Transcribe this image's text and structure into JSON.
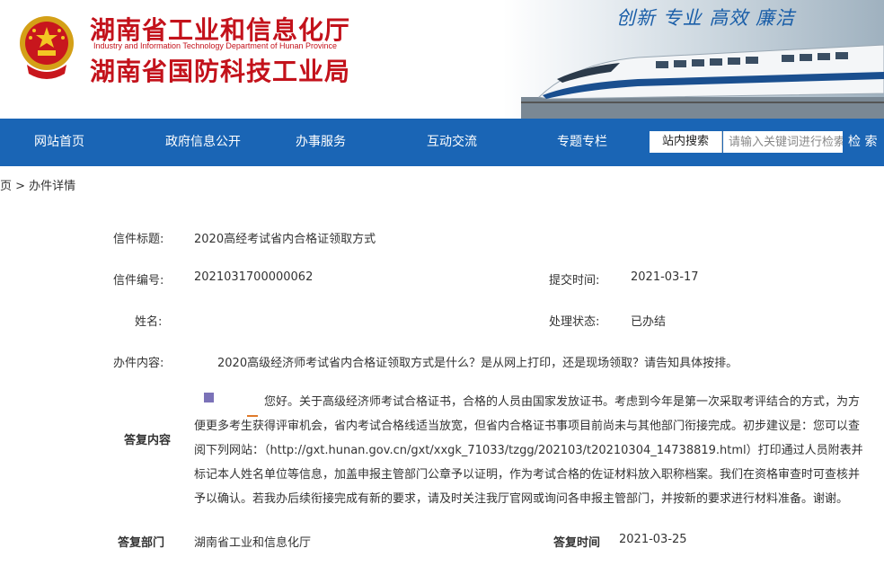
{
  "header": {
    "title_main": "湖南省工业和信息化厅",
    "title_en": "Industry and Information Technology Department of Hunan Province",
    "title_sub": "湖南省国防科技工业局",
    "slogan": "创新 专业 高效 廉洁"
  },
  "nav": {
    "items": [
      {
        "label": "网站首页"
      },
      {
        "label": "政府信息公开"
      },
      {
        "label": "办事服务"
      },
      {
        "label": "互动交流"
      },
      {
        "label": "专题专栏"
      }
    ],
    "search_label": "站内搜索",
    "search_placeholder": "请输入关键词进行检索",
    "search_button": "检 索"
  },
  "breadcrumb": "页 > 办件详情",
  "detail": {
    "title_label": "信件标题:",
    "title_value": "2020高经考试省内合格证领取方式",
    "number_label": "信件编号:",
    "number_value": "2021031700000062",
    "submit_time_label": "提交时间:",
    "submit_time_value": "2021-03-17",
    "name_label": "姓名:",
    "name_value": "",
    "status_label": "处理状态:",
    "status_value": "已办结",
    "content_label": "办件内容:",
    "content_value": "2020高级经济师考试省内合格证领取方式是什么？是从网上打印，还是现场领取？请告知具体按排。",
    "reply_label": "答复内容",
    "reply_value": "您好。关于高级经济师考试合格证书，合格的人员由国家发放证书。考虑到今年是第一次采取考评结合的方式，为方便更多考生获得评审机会，省内考试合格线适当放宽，但省内合格证书事项目前尚未与其他部门衔接完成。初步建议是：您可以查阅下列网站：（http://gxt.hunan.gov.cn/gxt/xxgk_71033/tzgg/202103/t20210304_14738819.html）打印通过人员附表并标记本人姓名单位等信息，加盖申报主管部门公章予以证明，作为考试合格的佐证材料放入职称档案。我们在资格审查时可查核并予以确认。若我办后续衔接完成有新的要求，请及时关注我厅官网或询问各申报主管部门，并按新的要求进行材料准备。谢谢。",
    "dept_label": "答复部门",
    "dept_value": "湖南省工业和信息化厅",
    "reply_time_label": "答复时间",
    "reply_time_value": "2021-03-25"
  }
}
